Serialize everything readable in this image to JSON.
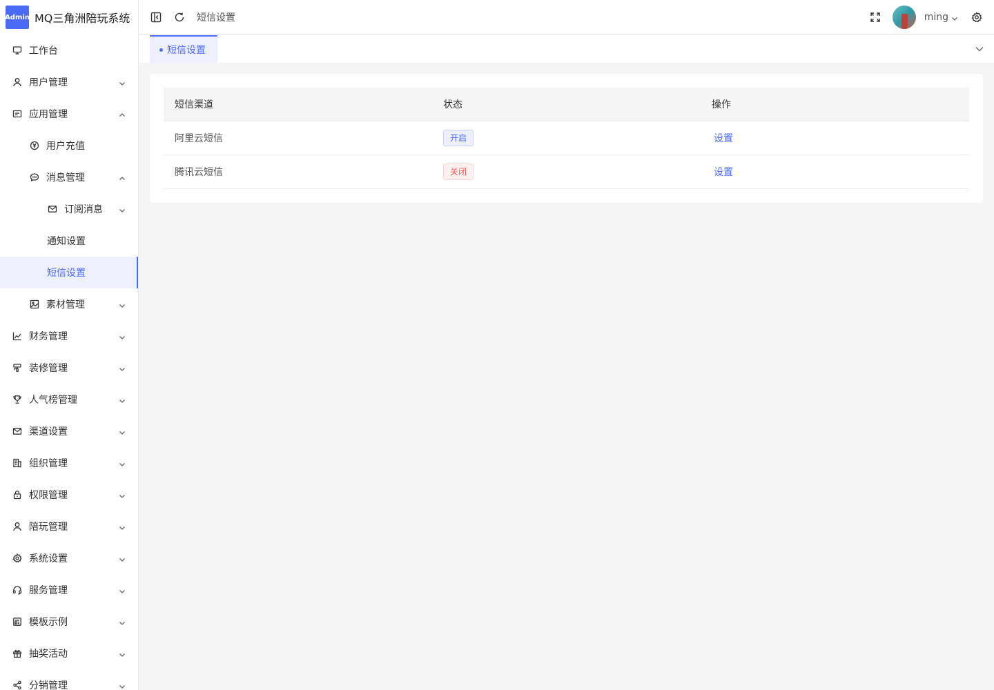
{
  "brand": {
    "logo_text": "Admin",
    "title": "MQ三角洲陪玩系统"
  },
  "sidebar": {
    "items": [
      {
        "label": "工作台",
        "icon": "monitor-icon",
        "level": 1,
        "arrow": "none"
      },
      {
        "label": "用户管理",
        "icon": "user-icon",
        "level": 1,
        "arrow": "down"
      },
      {
        "label": "应用管理",
        "icon": "app-icon",
        "level": 1,
        "arrow": "up"
      },
      {
        "label": "用户充值",
        "icon": "yen-circle-icon",
        "level": 2,
        "arrow": "none"
      },
      {
        "label": "消息管理",
        "icon": "chat-icon",
        "level": 2,
        "arrow": "up"
      },
      {
        "label": "订阅消息",
        "icon": "mail-icon",
        "level": 3,
        "arrow": "down"
      },
      {
        "label": "通知设置",
        "icon": "",
        "level": 3,
        "arrow": "none"
      },
      {
        "label": "短信设置",
        "icon": "",
        "level": 3,
        "arrow": "none",
        "active": true
      },
      {
        "label": "素材管理",
        "icon": "image-icon",
        "level": 2,
        "arrow": "down"
      },
      {
        "label": "财务管理",
        "icon": "chart-icon",
        "level": 1,
        "arrow": "down"
      },
      {
        "label": "装修管理",
        "icon": "brush-icon",
        "level": 1,
        "arrow": "down"
      },
      {
        "label": "人气榜管理",
        "icon": "trophy-icon",
        "level": 1,
        "arrow": "down"
      },
      {
        "label": "渠道设置",
        "icon": "mail-icon",
        "level": 1,
        "arrow": "down"
      },
      {
        "label": "组织管理",
        "icon": "building-icon",
        "level": 1,
        "arrow": "down"
      },
      {
        "label": "权限管理",
        "icon": "lock-icon",
        "level": 1,
        "arrow": "down"
      },
      {
        "label": "陪玩管理",
        "icon": "user-icon",
        "level": 1,
        "arrow": "down"
      },
      {
        "label": "系统设置",
        "icon": "gear-icon",
        "level": 1,
        "arrow": "down"
      },
      {
        "label": "服务管理",
        "icon": "headset-icon",
        "level": 1,
        "arrow": "down"
      },
      {
        "label": "模板示例",
        "icon": "template-icon",
        "level": 1,
        "arrow": "down"
      },
      {
        "label": "抽奖活动",
        "icon": "gift-icon",
        "level": 1,
        "arrow": "down"
      },
      {
        "label": "分销管理",
        "icon": "share-icon",
        "level": 1,
        "arrow": "down"
      }
    ]
  },
  "header": {
    "breadcrumb": "短信设置",
    "username": "ming"
  },
  "tabs": {
    "active_label": "短信设置"
  },
  "table": {
    "headers": [
      "短信渠道",
      "状态",
      "操作"
    ],
    "rows": [
      {
        "channel": "阿里云短信",
        "status": "开启",
        "status_type": "on",
        "action": "设置"
      },
      {
        "channel": "腾讯云短信",
        "status": "关闭",
        "status_type": "off",
        "action": "设置"
      }
    ]
  },
  "colors": {
    "accent": "#4c6bf5",
    "danger": "#f25c5c",
    "page_bg": "#f5f5f5"
  }
}
